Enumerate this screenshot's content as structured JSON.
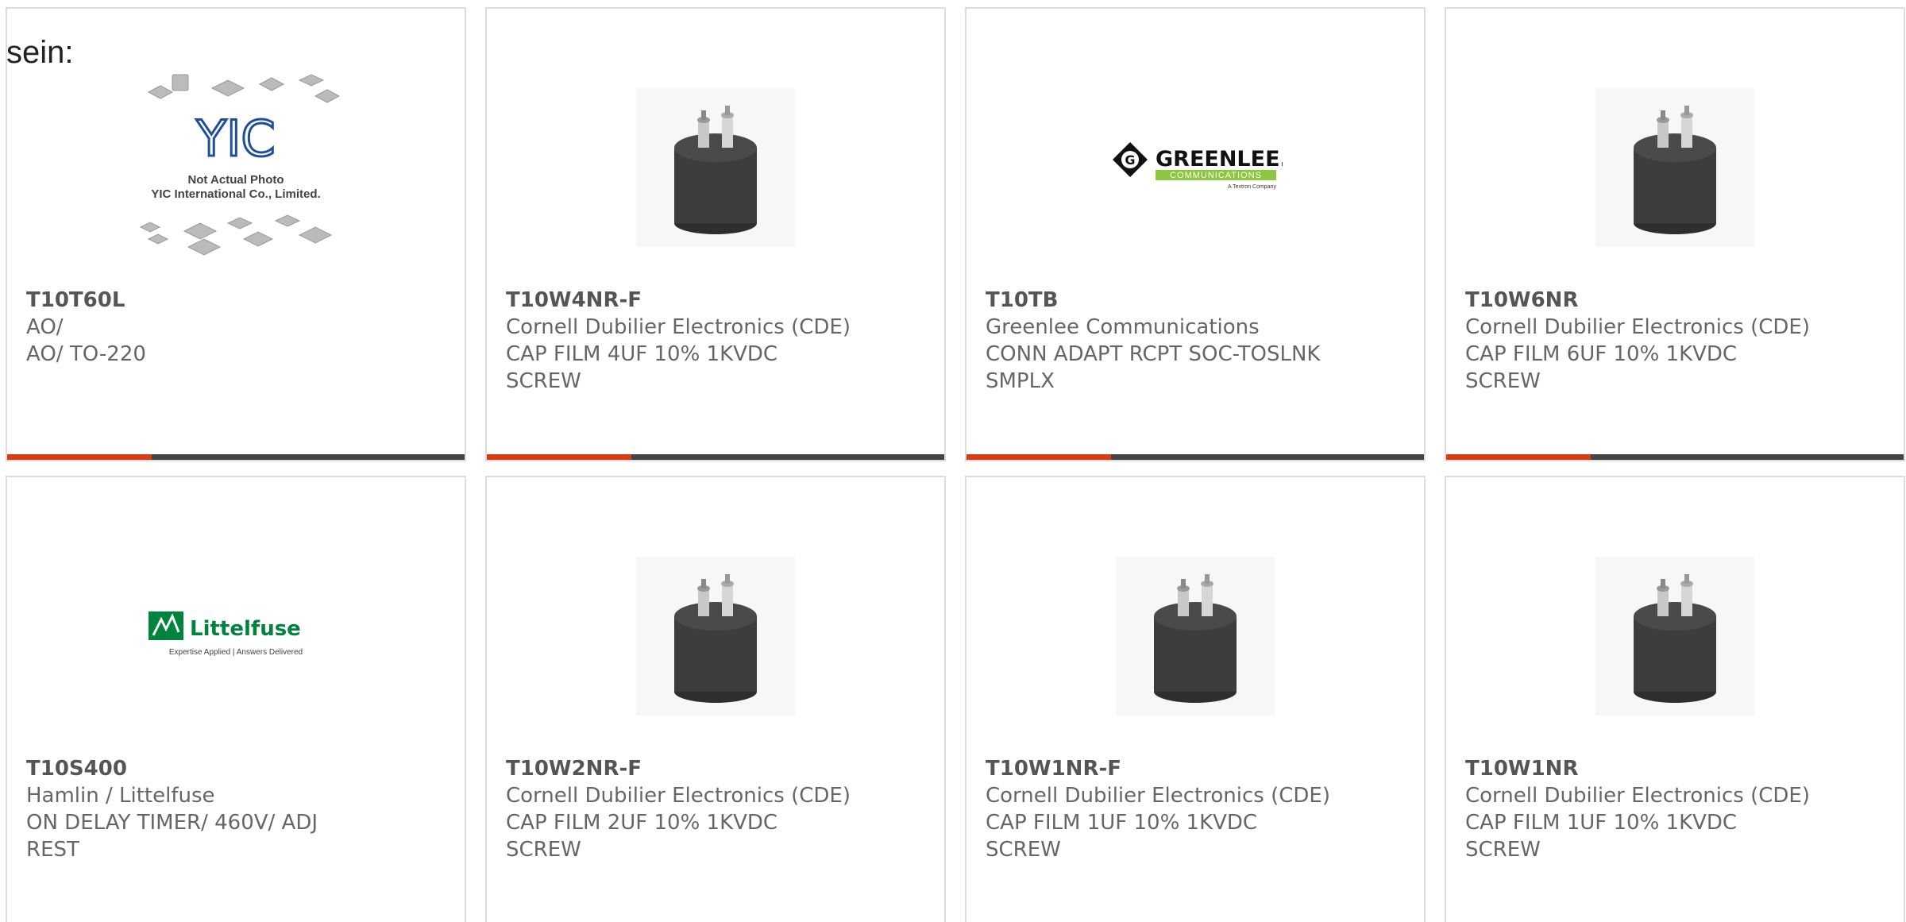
{
  "lead_text": "sein:",
  "products": [
    {
      "part": "T10T60L",
      "manufacturer": "AO/",
      "description": "AO/ TO-220",
      "description_line2": "",
      "image": "yic-placeholder-photo",
      "image_caption_1": "Not Actual Photo",
      "image_caption_2": "YIC International Co., Limited.",
      "logo_text": "YIC"
    },
    {
      "part": "T10W4NR-F",
      "manufacturer": "Cornell Dubilier Electronics (CDE)",
      "description": "CAP FILM 4UF 10% 1KVDC",
      "description_line2": "SCREW",
      "image": "film-capacitor-photo"
    },
    {
      "part": "T10TB",
      "manufacturer": "Greenlee Communications",
      "description": "CONN ADAPT RCPT SOC-TOSLNK",
      "description_line2": "SMPLX",
      "image": "greenlee-logo",
      "logo_text": "GREENLEE.",
      "logo_sub": "COMMUNICATIONS",
      "logo_tag": "A Textron Company"
    },
    {
      "part": "T10W6NR",
      "manufacturer": "Cornell Dubilier Electronics (CDE)",
      "description": "CAP FILM 6UF 10% 1KVDC",
      "description_line2": "SCREW",
      "image": "film-capacitor-photo"
    },
    {
      "part": "T10S400",
      "manufacturer": "Hamlin / Littelfuse",
      "description": "ON DELAY TIMER/ 460V/ ADJ",
      "description_line2": "REST",
      "image": "littelfuse-logo",
      "logo_text": "Littelfuse",
      "logo_tag": "Expertise Applied | Answers Delivered"
    },
    {
      "part": "T10W2NR-F",
      "manufacturer": "Cornell Dubilier Electronics (CDE)",
      "description": "CAP FILM 2UF 10% 1KVDC",
      "description_line2": "SCREW",
      "image": "film-capacitor-photo"
    },
    {
      "part": "T10W1NR-F",
      "manufacturer": "Cornell Dubilier Electronics (CDE)",
      "description": "CAP FILM 1UF 10% 1KVDC",
      "description_line2": "SCREW",
      "image": "film-capacitor-photo"
    },
    {
      "part": "T10W1NR",
      "manufacturer": "Cornell Dubilier Electronics (CDE)",
      "description": "CAP FILM 1UF 10% 1KVDC",
      "description_line2": "SCREW",
      "image": "film-capacitor-photo"
    }
  ],
  "colors": {
    "accent": "#dd3a0f",
    "bar": "#444444",
    "greenlee_green": "#8dc63f",
    "littelfuse_green": "#00843d",
    "yic_blue": "#1f4e9c"
  }
}
